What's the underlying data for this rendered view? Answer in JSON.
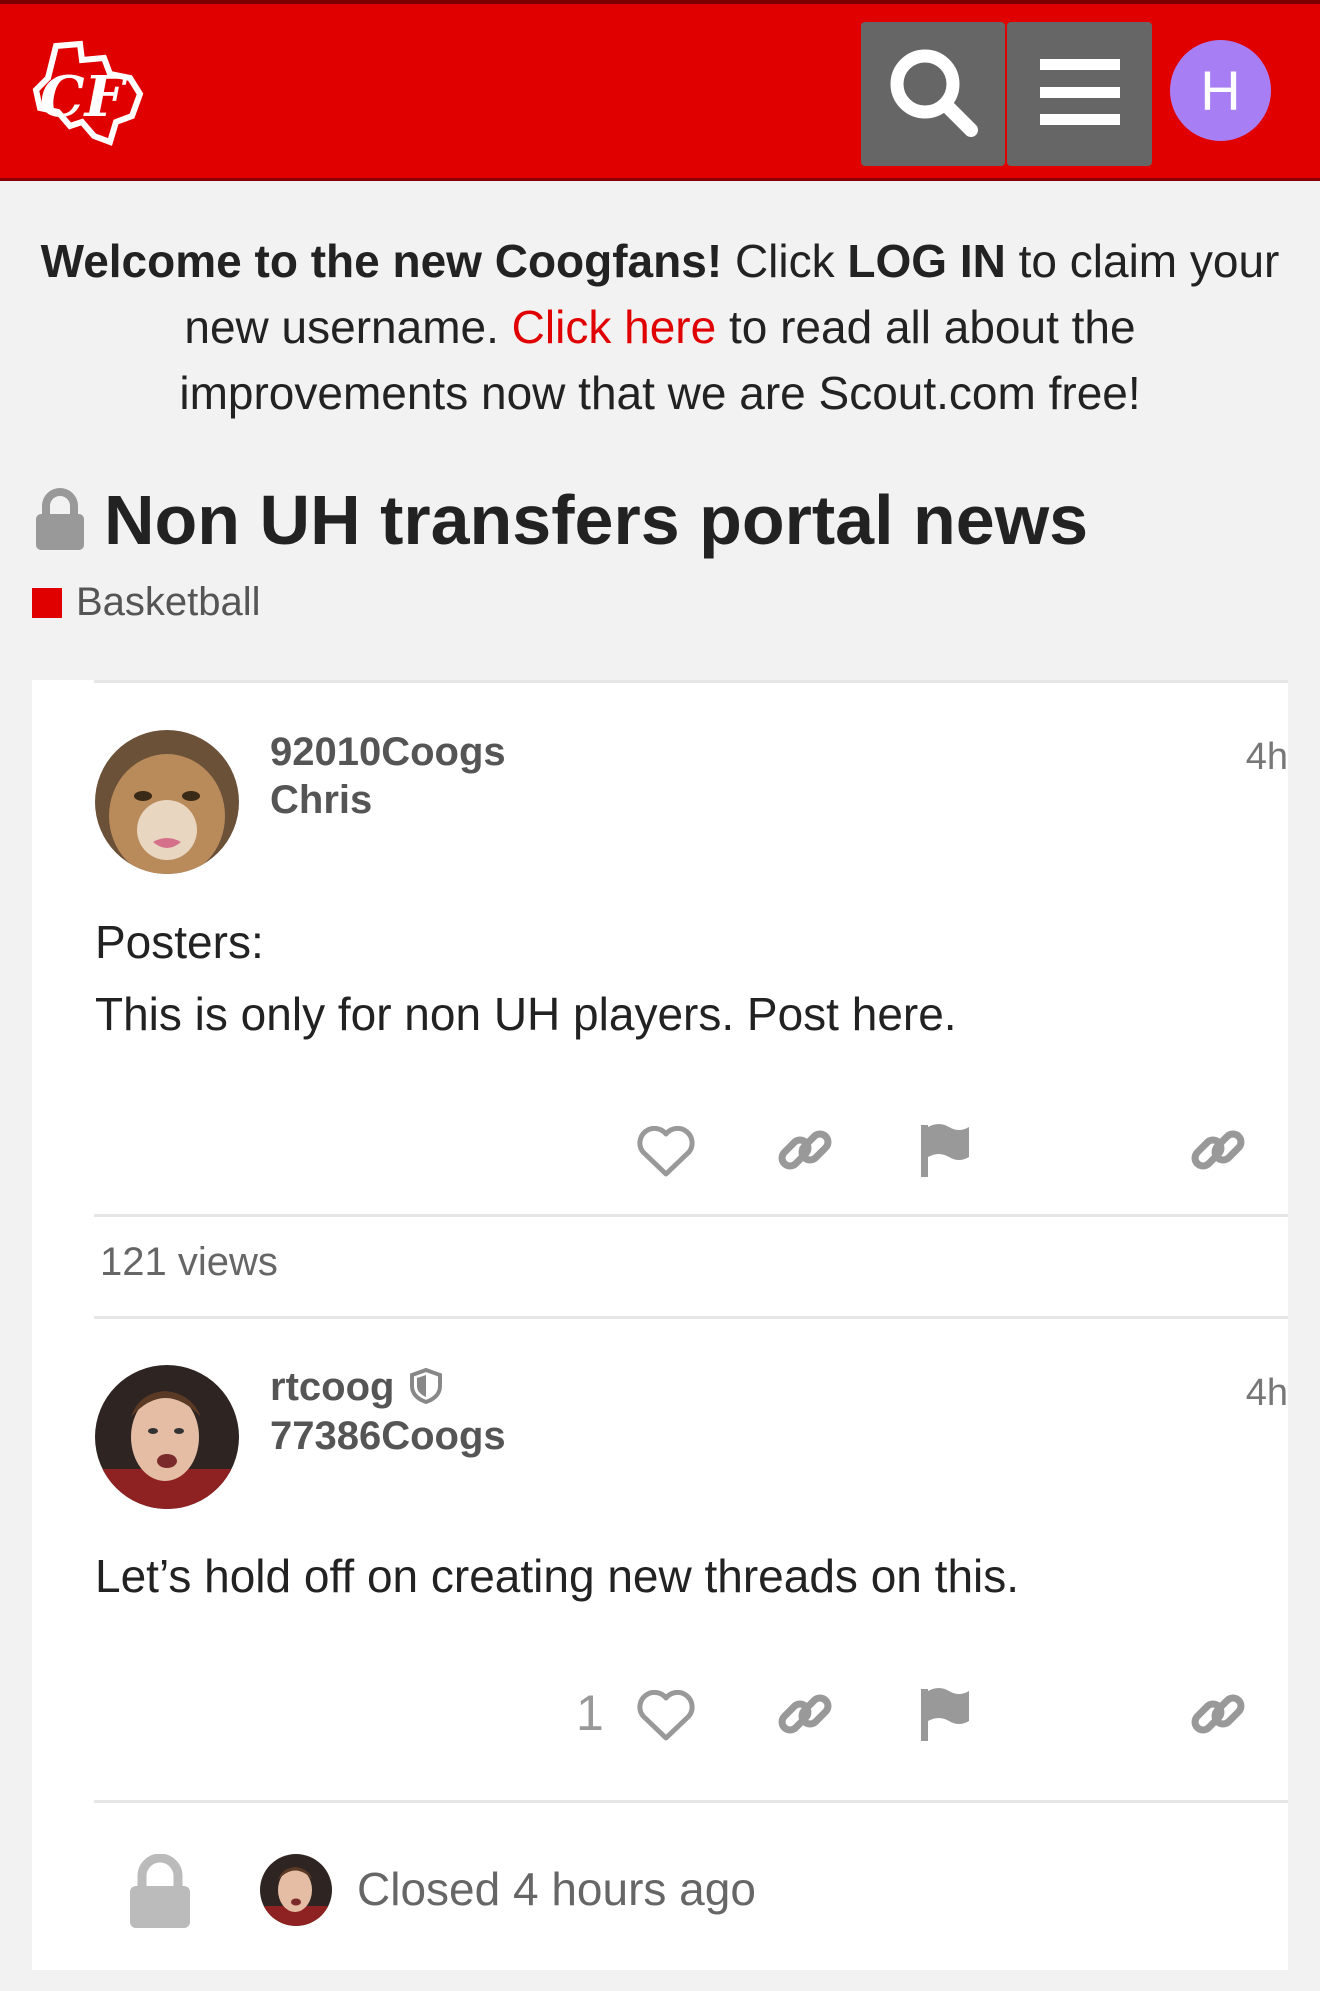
{
  "header": {
    "logo_text": "CF",
    "search_icon": "search-icon",
    "menu_icon": "hamburger-menu-icon",
    "user_initial": "H",
    "colors": {
      "brand": "#e00000",
      "avatar": "#a87ef5",
      "button": "#666666"
    }
  },
  "banner": {
    "bold_welcome": "Welcome to the new Coogfans!",
    "text_click": "Click",
    "bold_login": "LOG IN",
    "text_claim": "to claim your new username.",
    "link_click_here": "Click here",
    "text_rest": "to read all about the improvements now that we are Scout.com free!"
  },
  "topic": {
    "title": "Non UH transfers portal news",
    "category": "Basketball",
    "category_color": "#e00000"
  },
  "posts": [
    {
      "username": "92010Coogs",
      "name": "Chris",
      "time": "4h",
      "lines": [
        "Posters:",
        "This is only for non UH players. Post here."
      ],
      "like_count": ""
    },
    {
      "username": "rtcoog",
      "name": "77386Coogs",
      "time": "4h",
      "lines": [
        "Let’s hold off on creating new threads on this."
      ],
      "like_count": "1"
    }
  ],
  "views": {
    "count": "121",
    "label": "views"
  },
  "closed": {
    "text": "Closed 4 hours ago"
  }
}
